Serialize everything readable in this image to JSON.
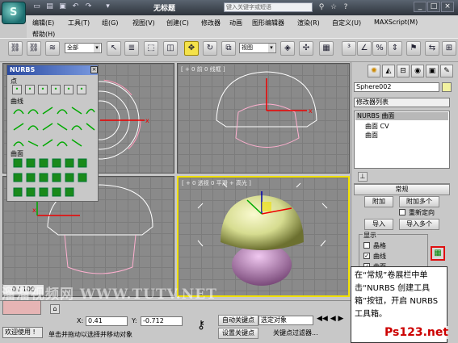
{
  "window": {
    "title": "无标题",
    "search_placeholder": "键入关键字或短语"
  },
  "menu": {
    "row1": [
      "编辑(E)",
      "工具(T)",
      "组(G)",
      "视图(V)",
      "创建(C)",
      "修改器",
      "动画",
      "图形编辑器",
      "渲染(R)",
      "自定义(U)",
      "MAXScript(M)"
    ],
    "row2": [
      "帮助(H)"
    ]
  },
  "toolbar": {
    "selection_filter": "全部",
    "ref_coord": "视图"
  },
  "nurbs_panel": {
    "title": "NURBS",
    "close": "×",
    "section_point": "点",
    "section_curve": "曲线",
    "section_surface": "曲面"
  },
  "viewports": {
    "top_left_label": "",
    "top_right_label": "[ + 0 前 0 线框 ]",
    "bottom_left_label": "",
    "bottom_right_label": "[ + 0 透视 0 平滑 + 高光 ]"
  },
  "command_panel": {
    "object_name": "Sphere002",
    "modifier_list": "修改器列表",
    "stack": [
      "NURBS 曲面",
      "曲面 CV",
      "曲面"
    ],
    "rollout_title": "常规",
    "attach": "附加",
    "attach_multiple": "附加多个",
    "reorient": "重新定向",
    "import": "导入",
    "import_multiple": "导入多个",
    "display_label": "显示",
    "display_items": [
      "晶格",
      "曲线",
      "曲面"
    ],
    "display_checked": [
      false,
      true,
      true
    ]
  },
  "status": {
    "frame": "0 / 100",
    "x_label": "X:",
    "x_value": "0.41",
    "y_label": "Y:",
    "y_value": "-0.712",
    "welcome": "欢迎使用 !",
    "prompt": "单击并拖动以选择并移动对象",
    "auto_key": "自动关键点",
    "set_key": "设置关键点",
    "key_filter_select": "选定对象",
    "key_filters": "关键点过滤器..."
  },
  "tooltip": "在“常规”卷展栏中单击“NURBS 创建工具箱”按钮，开启 NURBS 工具箱。",
  "watermarks": {
    "left": "溜溜视频网 WWW.TUTV.NET",
    "right": "Ps123.net"
  }
}
